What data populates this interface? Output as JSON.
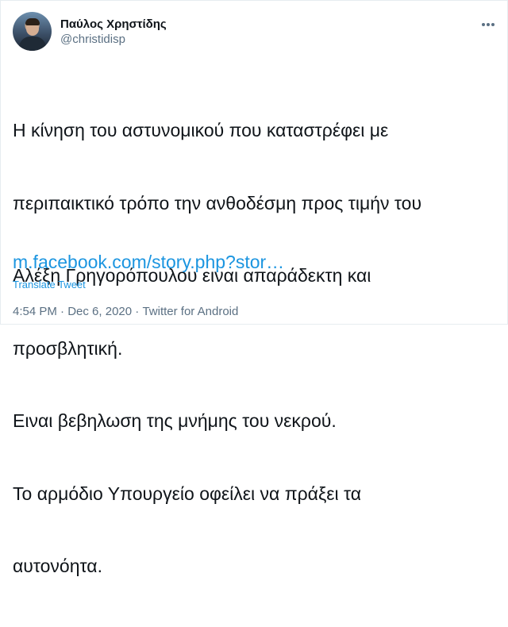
{
  "author": {
    "display_name": "Παύλος Χρηστίδης",
    "handle": "@christidisp"
  },
  "tweet": {
    "lines": [
      "Η κίνηση του αστυνομικού που καταστρέφει με",
      "περιπαικτικό τρόπο την ανθοδέσμη προς τιμήν του",
      "Αλέξη Γρηγορόπουλου ειναι απαράδεκτη και",
      "προσβλητική.",
      "Ειναι βεβηλωση της μνήμης του νεκρού.",
      "Το αρμόδιο Υπουργείο οφείλει να πράξει τα",
      "αυτονόητα."
    ],
    "link_text": "m.facebook.com/story.php?stor…",
    "translate_label": "Translate Tweet"
  },
  "meta": {
    "time": "4:54 PM",
    "separator": " · ",
    "date": "Dec 6, 2020",
    "source": "Twitter for Android"
  },
  "icons": {
    "more": "more-options-icon"
  },
  "colors": {
    "link": "#1b95e0",
    "secondary": "#5b7083",
    "text": "#0f1419"
  }
}
